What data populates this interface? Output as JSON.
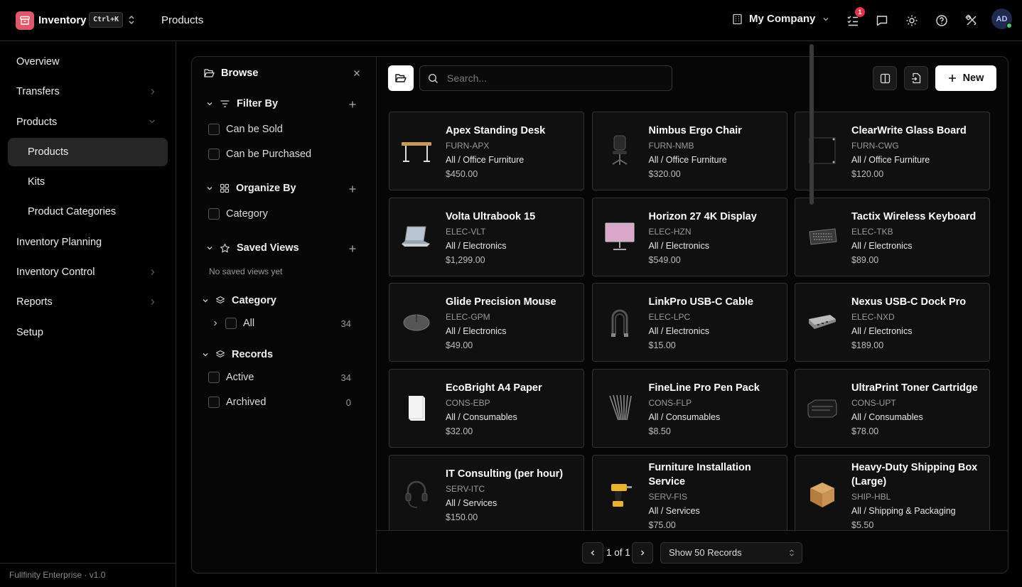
{
  "app": {
    "name": "Inventory",
    "shortcut": "Ctrl+K",
    "breadcrumb": "Products"
  },
  "header": {
    "company": "My Company",
    "notification_count": "1",
    "avatar_initials": "AD"
  },
  "sidebar": {
    "items": [
      {
        "label": "Overview"
      },
      {
        "label": "Transfers"
      },
      {
        "label": "Products"
      },
      {
        "label": "Products"
      },
      {
        "label": "Kits"
      },
      {
        "label": "Product Categories"
      },
      {
        "label": "Inventory Planning"
      },
      {
        "label": "Inventory Control"
      },
      {
        "label": "Reports"
      },
      {
        "label": "Setup"
      }
    ],
    "footer": "Fullfinity Enterprise · v1.0"
  },
  "browse": {
    "title": "Browse",
    "filter_by": {
      "label": "Filter By",
      "options": [
        "Can be Sold",
        "Can be Purchased"
      ]
    },
    "organize_by": {
      "label": "Organize By",
      "options": [
        "Category"
      ]
    },
    "saved_views": {
      "label": "Saved Views",
      "empty": "No saved views yet"
    },
    "category": {
      "label": "Category",
      "all_label": "All",
      "all_count": "34"
    },
    "records": {
      "label": "Records",
      "active_label": "Active",
      "active_count": "34",
      "archived_label": "Archived",
      "archived_count": "0"
    }
  },
  "toolbar": {
    "search_placeholder": "Search...",
    "new_label": "New"
  },
  "products": [
    {
      "name": "Apex Standing Desk",
      "sku": "FURN-APX",
      "category": "All / Office Furniture",
      "price": "$450.00",
      "icon": "desk-icon"
    },
    {
      "name": "Nimbus Ergo Chair",
      "sku": "FURN-NMB",
      "category": "All / Office Furniture",
      "price": "$320.00",
      "icon": "chair-icon"
    },
    {
      "name": "ClearWrite Glass Board",
      "sku": "FURN-CWG",
      "category": "All / Office Furniture",
      "price": "$120.00",
      "icon": "board-icon"
    },
    {
      "name": "Volta Ultrabook 15",
      "sku": "ELEC-VLT",
      "category": "All / Electronics",
      "price": "$1,299.00",
      "icon": "laptop-icon"
    },
    {
      "name": "Horizon 27 4K Display",
      "sku": "ELEC-HZN",
      "category": "All / Electronics",
      "price": "$549.00",
      "icon": "monitor-icon"
    },
    {
      "name": "Tactix Wireless Keyboard",
      "sku": "ELEC-TKB",
      "category": "All / Electronics",
      "price": "$89.00",
      "icon": "keyboard-icon"
    },
    {
      "name": "Glide Precision Mouse",
      "sku": "ELEC-GPM",
      "category": "All / Electronics",
      "price": "$49.00",
      "icon": "mouse-icon"
    },
    {
      "name": "LinkPro USB-C Cable",
      "sku": "ELEC-LPC",
      "category": "All / Electronics",
      "price": "$15.00",
      "icon": "cable-icon"
    },
    {
      "name": "Nexus USB-C Dock Pro",
      "sku": "ELEC-NXD",
      "category": "All / Electronics",
      "price": "$189.00",
      "icon": "dock-icon"
    },
    {
      "name": "EcoBright A4 Paper",
      "sku": "CONS-EBP",
      "category": "All / Consumables",
      "price": "$32.00",
      "icon": "paper-icon"
    },
    {
      "name": "FineLine Pro Pen Pack",
      "sku": "CONS-FLP",
      "category": "All / Consumables",
      "price": "$8.50",
      "icon": "pens-icon"
    },
    {
      "name": "UltraPrint Toner Cartridge",
      "sku": "CONS-UPT",
      "category": "All / Consumables",
      "price": "$78.00",
      "icon": "toner-icon"
    },
    {
      "name": "IT Consulting (per hour)",
      "sku": "SERV-ITC",
      "category": "All / Services",
      "price": "$150.00",
      "icon": "headset-icon"
    },
    {
      "name": "Furniture Installation Service",
      "sku": "SERV-FIS",
      "category": "All / Services",
      "price": "$75.00",
      "icon": "drill-icon"
    },
    {
      "name": "Heavy-Duty Shipping Box (Large)",
      "sku": "SHIP-HBL",
      "category": "All / Shipping & Packaging",
      "price": "$5.50",
      "icon": "box-icon"
    }
  ],
  "pagination": {
    "label": "1 of 1",
    "page_size": "Show 50 Records"
  }
}
